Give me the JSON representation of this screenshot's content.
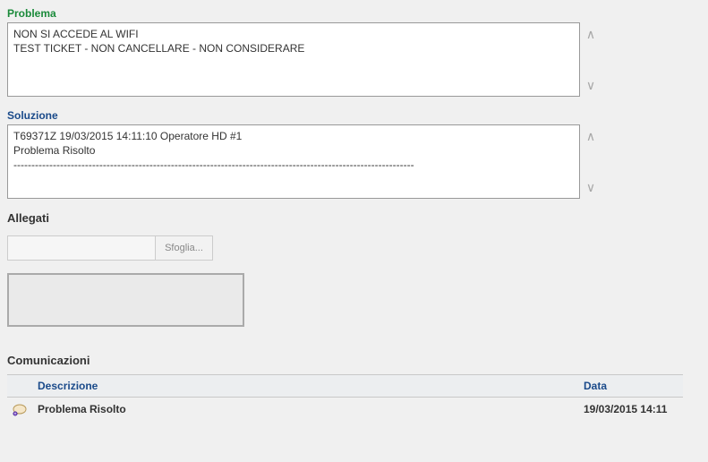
{
  "problema": {
    "label": "Problema",
    "text": "NON SI ACCEDE AL WIFI\nTEST TICKET - NON CANCELLARE - NON CONSIDERARE"
  },
  "soluzione": {
    "label": "Soluzione",
    "text": "T69371Z 19/03/2015 14:11:10 Operatore HD #1\nProblema Risolto\n----------------------------------------------------------------------------------------------------------------"
  },
  "allegati": {
    "label": "Allegati",
    "browse_label": "Sfoglia..."
  },
  "comunicazioni": {
    "label": "Comunicazioni",
    "headers": {
      "descrizione": "Descrizione",
      "data": "Data"
    },
    "rows": [
      {
        "descrizione": "Problema Risolto",
        "data": "19/03/2015 14:11"
      }
    ]
  }
}
